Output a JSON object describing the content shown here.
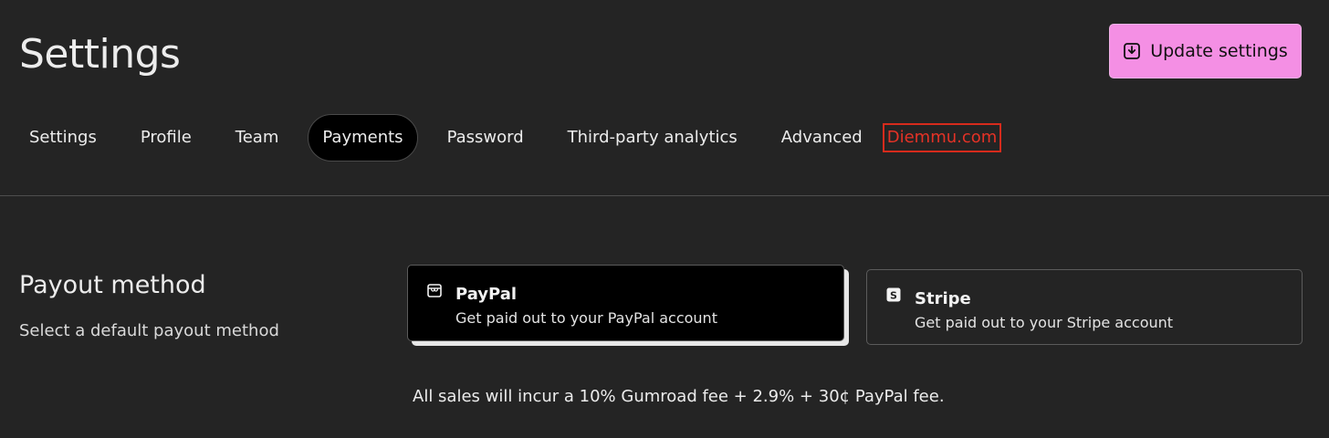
{
  "header": {
    "title": "Settings",
    "update_button_label": "Update settings"
  },
  "tabs": [
    {
      "label": "Settings",
      "active": false
    },
    {
      "label": "Profile",
      "active": false
    },
    {
      "label": "Team",
      "active": false
    },
    {
      "label": "Payments",
      "active": true
    },
    {
      "label": "Password",
      "active": false
    },
    {
      "label": "Third-party analytics",
      "active": false
    },
    {
      "label": "Advanced",
      "active": false
    }
  ],
  "watermark_link": "Diemmu.com",
  "payout": {
    "title": "Payout method",
    "description": "Select a default payout method",
    "options": [
      {
        "name": "PayPal",
        "description": "Get paid out to your PayPal account",
        "icon": "store-icon",
        "selected": true
      },
      {
        "name": "Stripe",
        "description": "Get paid out to your Stripe account",
        "icon": "stripe-icon",
        "selected": false
      }
    ],
    "fee_note": "All sales will incur a 10% Gumroad fee + 2.9% + 30¢ PayPal fee."
  },
  "colors": {
    "background": "#242424",
    "accent_button": "#f48fe4",
    "active_tab": "#000000",
    "link_red": "#e53226"
  }
}
